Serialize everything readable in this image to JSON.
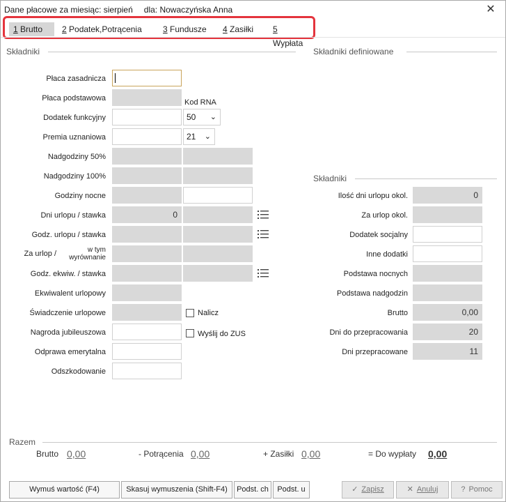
{
  "window": {
    "title": "Dane płacowe za miesiąc: sierpień",
    "dla": "dla:  Nowaczyńska Anna",
    "close": "✕"
  },
  "tabs": [
    {
      "key": "1",
      "label": " Brutto"
    },
    {
      "key": "2",
      "label": " Podatek,Potrącenia"
    },
    {
      "key": "3",
      "label": " Fundusze"
    },
    {
      "key": "4",
      "label": " Zasiłki"
    },
    {
      "key": "5",
      "label": " Wypłata"
    }
  ],
  "left": {
    "section": "Składniki",
    "kod_rna": "Kod RNA",
    "rows": {
      "placa_zasadnicza": "Płaca zasadnicza",
      "placa_podstawowa": "Płaca podstawowa",
      "dodatek_funkcyjny": "Dodatek funkcyjny",
      "premia_uznaniowa": "Premia uznaniowa",
      "nadgodziny_50": "Nadgodziny 50%",
      "nadgodziny_100": "Nadgodziny 100%",
      "godziny_nocne": "Godziny nocne",
      "dni_urlopu": "Dni urlopu / stawka",
      "godz_urlopu": "Godz. urlopu / stawka",
      "za_urlop": "Za urlop /",
      "w_tym": "w tym",
      "wyrownanie": "wyrównanie",
      "godz_ekwiw": "Godz. ekwiw. / stawka",
      "ekwiwalent": "Ekwiwalent urlopowy",
      "swiadczenie": "Świadczenie urlopowe",
      "nagroda": "Nagroda jubileuszowa",
      "odprawa": "Odprawa emerytalna",
      "odszkodowanie": "Odszkodowanie"
    },
    "values": {
      "dodatek_kod": "50",
      "premia_kod": "21",
      "dni_urlopu": "0"
    },
    "checkboxes": {
      "nalicz": "Nalicz",
      "wyslij": "Wyślij do ZUS"
    }
  },
  "right": {
    "section_defined": "Składniki definiowane",
    "section": "Składniki",
    "rows": {
      "ilosc_dni": "Ilość dni urlopu okol.",
      "za_urlop_okol": "Za urlop okol.",
      "dodatek_socjalny": "Dodatek socjalny",
      "inne_dodatki": "Inne dodatki",
      "podstawa_nocnych": "Podstawa nocnych",
      "podstawa_nadgodzin": "Podstawa nadgodzin",
      "brutto": "Brutto",
      "dni_do": "Dni do przepracowania",
      "dni_przepr": "Dni przepracowane"
    },
    "values": {
      "ilosc_dni": "0",
      "brutto": "0,00",
      "dni_do": "20",
      "dni_przepr": "11"
    }
  },
  "razem": {
    "title": "Razem",
    "brutto_label": "Brutto",
    "brutto_value": "0,00",
    "potracenia_label": "- Potrącenia",
    "potracenia_value": "0,00",
    "zasilki_label": "+ Zasiłki",
    "zasilki_value": "0,00",
    "do_wyplaty_label": "= Do wypłaty",
    "do_wyplaty_value": "0,00"
  },
  "buttons": {
    "wymus": "Wymuś wartość (F4)",
    "skasuj": "Skasuj wymuszenia (Shift-F4)",
    "podst_ch": "Podst. ch",
    "podst_u": "Podst. u",
    "zapisz": "Zapisz",
    "anuluj": "Anuluj",
    "pomoc": "Pomoc"
  }
}
